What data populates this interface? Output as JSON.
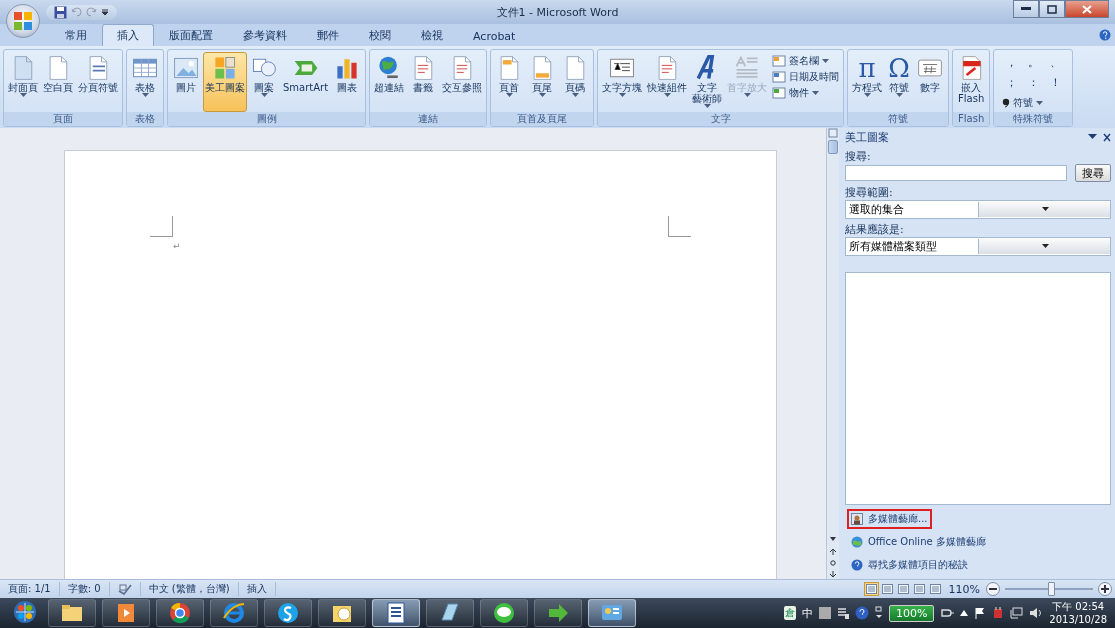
{
  "window": {
    "title": "文件1 - Microsoft Word"
  },
  "tabs": [
    {
      "label": "常用",
      "selected": false
    },
    {
      "label": "插入",
      "selected": true
    },
    {
      "label": "版面配置",
      "selected": false
    },
    {
      "label": "參考資料",
      "selected": false
    },
    {
      "label": "郵件",
      "selected": false
    },
    {
      "label": "校閱",
      "selected": false
    },
    {
      "label": "檢視",
      "selected": false
    },
    {
      "label": "Acrobat",
      "selected": false
    }
  ],
  "ribbon": {
    "groups": [
      {
        "label": "頁面",
        "kind": "large",
        "buttons": [
          {
            "lines": [
              "封面頁"
            ],
            "dropdown": true,
            "selected": false,
            "disabled": false
          },
          {
            "lines": [
              "空白頁"
            ],
            "dropdown": false,
            "selected": false,
            "disabled": false
          },
          {
            "lines": [
              "分頁符號"
            ],
            "dropdown": false,
            "selected": false,
            "disabled": false
          }
        ]
      },
      {
        "label": "表格",
        "kind": "large",
        "buttons": [
          {
            "lines": [
              "表格"
            ],
            "dropdown": true,
            "selected": false,
            "disabled": false
          }
        ]
      },
      {
        "label": "圖例",
        "kind": "large",
        "buttons": [
          {
            "lines": [
              "圖片"
            ],
            "dropdown": false,
            "selected": false,
            "disabled": false
          },
          {
            "lines": [
              "美工圖案"
            ],
            "dropdown": false,
            "selected": true,
            "disabled": false
          },
          {
            "lines": [
              "圖案"
            ],
            "dropdown": true,
            "selected": false,
            "disabled": false
          },
          {
            "lines": [
              "SmartArt"
            ],
            "dropdown": false,
            "selected": false,
            "disabled": false
          },
          {
            "lines": [
              "圖表"
            ],
            "dropdown": false,
            "selected": false,
            "disabled": false
          }
        ]
      },
      {
        "label": "連結",
        "kind": "large",
        "buttons": [
          {
            "lines": [
              "超連結"
            ],
            "dropdown": false,
            "selected": false,
            "disabled": false
          },
          {
            "lines": [
              "書籤"
            ],
            "dropdown": false,
            "selected": false,
            "disabled": false
          },
          {
            "lines": [
              "交互參照"
            ],
            "dropdown": false,
            "selected": false,
            "disabled": false
          }
        ]
      },
      {
        "label": "頁首及頁尾",
        "kind": "large",
        "buttons": [
          {
            "lines": [
              "頁首"
            ],
            "dropdown": true,
            "selected": false,
            "disabled": false
          },
          {
            "lines": [
              "頁尾"
            ],
            "dropdown": true,
            "selected": false,
            "disabled": false
          },
          {
            "lines": [
              "頁碼"
            ],
            "dropdown": true,
            "selected": false,
            "disabled": false
          }
        ]
      },
      {
        "label": "文字",
        "kind": "large",
        "buttons": [
          {
            "lines": [
              "文字方塊"
            ],
            "dropdown": true,
            "selected": false,
            "disabled": false
          },
          {
            "lines": [
              "快速組件"
            ],
            "dropdown": true,
            "selected": false,
            "disabled": false
          },
          {
            "lines": [
              "文字",
              "藝術師"
            ],
            "dropdown": true,
            "selected": false,
            "disabled": false
          },
          {
            "lines": [
              "首字放大"
            ],
            "dropdown": true,
            "selected": false,
            "disabled": true
          }
        ],
        "small_buttons": [
          {
            "label": "簽名欄",
            "dropdown": true
          },
          {
            "label": "日期及時間",
            "dropdown": false
          },
          {
            "label": "物件",
            "dropdown": true
          }
        ]
      },
      {
        "label": "符號",
        "kind": "large",
        "buttons": [
          {
            "lines": [
              "方程式"
            ],
            "glyph": "π",
            "dropdown": true,
            "selected": false,
            "disabled": false
          },
          {
            "lines": [
              "符號"
            ],
            "glyph": "Ω",
            "dropdown": true,
            "selected": false,
            "disabled": false
          },
          {
            "lines": [
              "數字"
            ],
            "dropdown": false,
            "selected": false,
            "disabled": false
          }
        ]
      },
      {
        "label": "Flash",
        "kind": "large",
        "buttons": [
          {
            "lines": [
              "嵌入",
              "Flash"
            ],
            "dropdown": false,
            "selected": false,
            "disabled": false
          }
        ]
      },
      {
        "label": "特殊符號",
        "kind": "symbols",
        "symbols": [
          "，",
          "。",
          "、",
          "；",
          "：",
          "！"
        ],
        "menu": {
          "label": "符號",
          "dropdown": true
        }
      }
    ]
  },
  "document": {
    "paragraph_mark": "↵"
  },
  "task_pane": {
    "title": "美工圖案",
    "search_label": "搜尋:",
    "search_button": "搜尋",
    "scope_label": "搜尋範圍:",
    "scope_value": "選取的集合",
    "type_label": "結果應該是:",
    "type_value": "所有媒體檔案類型",
    "links": [
      {
        "label": "多媒體藝廊...",
        "highlighted": true
      },
      {
        "label": "Office Online 多媒體藝廊",
        "highlighted": false
      },
      {
        "label": "尋找多媒體項目的秘訣",
        "highlighted": false
      }
    ]
  },
  "status_bar": {
    "items": [
      "頁面: 1/1",
      "字數: 0",
      "中文 (繁體，台灣)",
      "插入"
    ],
    "views": [
      {
        "selected": true
      },
      {
        "selected": false
      },
      {
        "selected": false
      },
      {
        "selected": false
      },
      {
        "selected": false
      }
    ],
    "zoom": "110%",
    "level": 0.53
  },
  "taskbar": {
    "apps": [
      {
        "active": false
      },
      {
        "active": false
      },
      {
        "active": false
      },
      {
        "active": false
      },
      {
        "active": false
      },
      {
        "active": false
      },
      {
        "active": true
      },
      {
        "active": false
      },
      {
        "active": false
      },
      {
        "active": false
      },
      {
        "active": true
      }
    ],
    "ime": "倉",
    "input_mode": "中",
    "battery": "100%",
    "time": "下午 02:54",
    "date": "2013/10/28"
  }
}
